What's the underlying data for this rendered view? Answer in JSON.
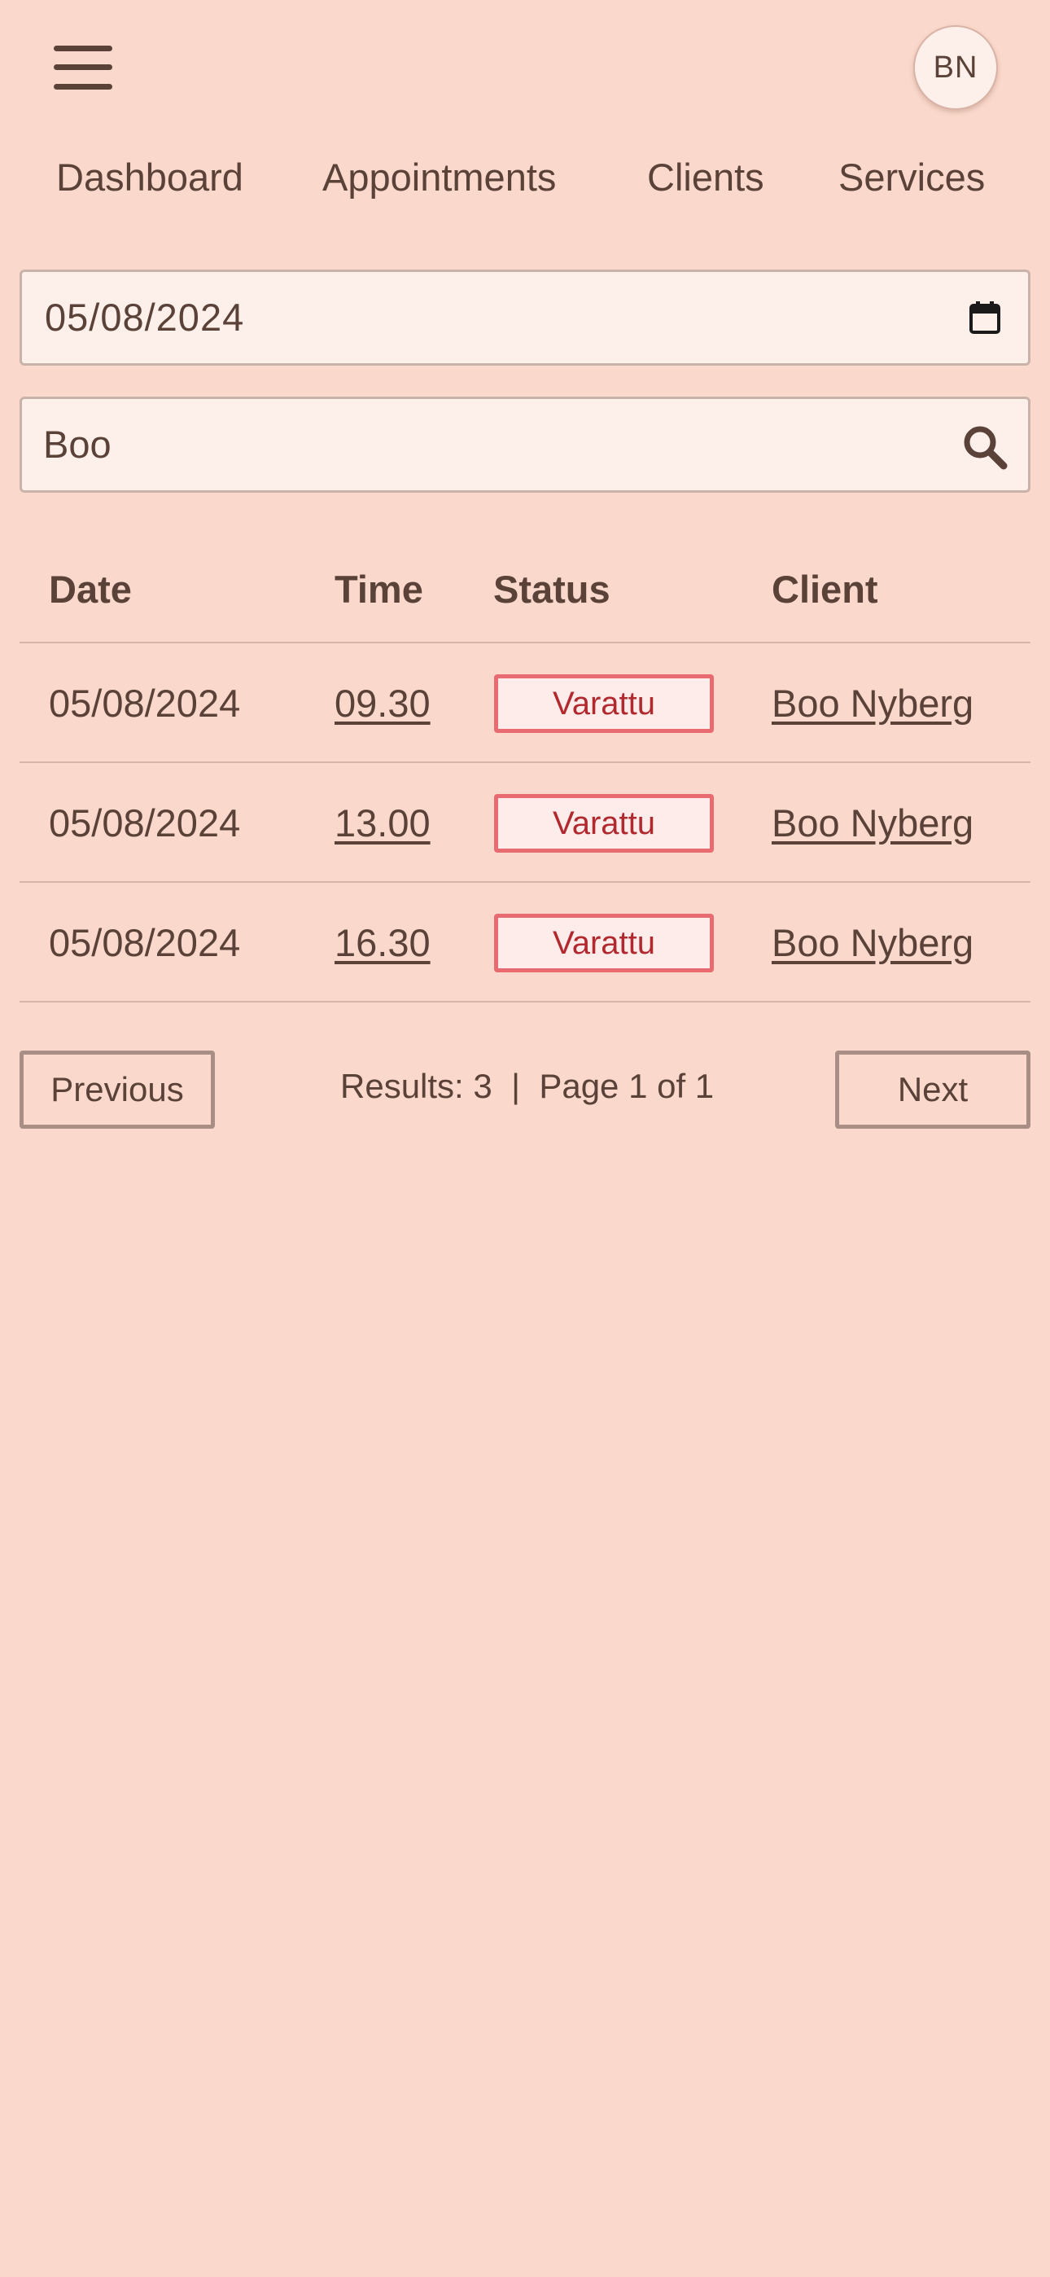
{
  "header": {
    "avatar_initials": "BN"
  },
  "nav": {
    "items": [
      {
        "label": "Dashboard"
      },
      {
        "label": "Appointments"
      },
      {
        "label": "Clients"
      },
      {
        "label": "Services"
      }
    ]
  },
  "filters": {
    "date_value": "05/08/2024",
    "search_value": "Boo"
  },
  "table": {
    "columns": [
      "Date",
      "Time",
      "Status",
      "Client"
    ],
    "rows": [
      {
        "date": "05/08/2024",
        "time": "09.30",
        "status": "Varattu",
        "client": "Boo Nyberg"
      },
      {
        "date": "05/08/2024",
        "time": "13.00",
        "status": "Varattu",
        "client": "Boo Nyberg"
      },
      {
        "date": "05/08/2024",
        "time": "16.30",
        "status": "Varattu",
        "client": "Boo Nyberg"
      }
    ]
  },
  "pagination": {
    "previous_label": "Previous",
    "next_label": "Next",
    "info": "Results: 3  |  Page 1 of 1"
  },
  "colors": {
    "background": "#fad8cb",
    "text": "#5a4239",
    "status_border": "#e86b72",
    "status_text": "#b1282e"
  }
}
